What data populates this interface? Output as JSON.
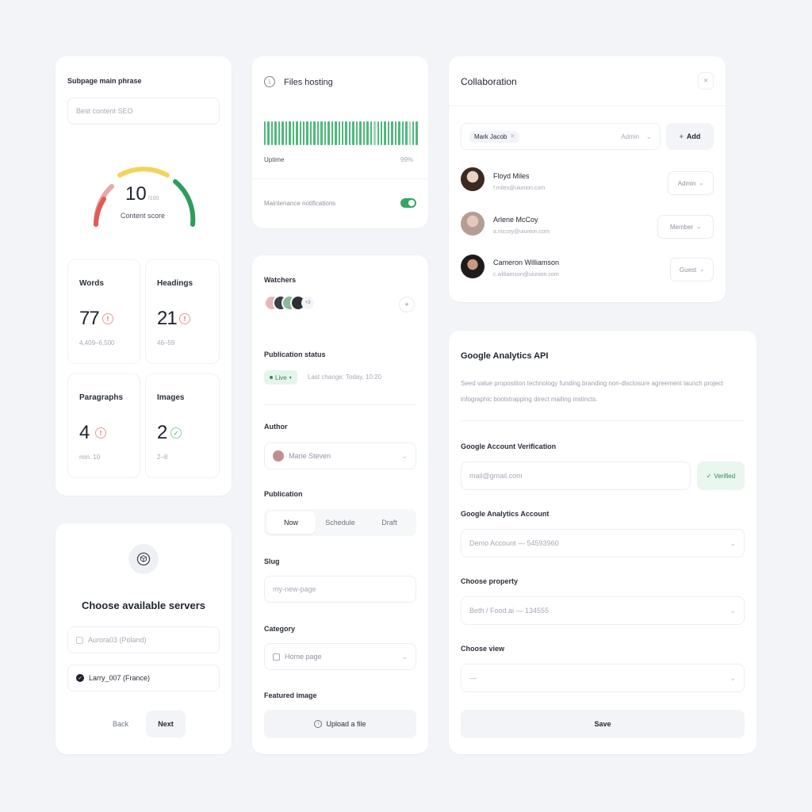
{
  "seo": {
    "label": "Subpage main phrase",
    "placeholder": "Best content SEO",
    "score": "10",
    "score_unit": "/100",
    "score_label": "Content score",
    "stats": [
      {
        "title": "Words",
        "value": "77",
        "range": "4,409–6,500",
        "status": "red"
      },
      {
        "title": "Headings",
        "value": "21",
        "range": "46–59",
        "status": "red"
      },
      {
        "title": "Paragraphs",
        "value": "4",
        "range": "min. 10",
        "status": "red"
      },
      {
        "title": "Images",
        "value": "2",
        "range": "2–8",
        "status": "green"
      }
    ],
    "gauge_level": 0.1
  },
  "servers": {
    "title": "Choose available servers",
    "options": [
      "Aurora03 (Poland)",
      "Larry_007 (France)"
    ],
    "selected_index": 1,
    "back_label": "Back",
    "next_label": "Next"
  },
  "hosting": {
    "title": "Files hosting",
    "uptime_label": "Uptime",
    "uptime_value": "99%",
    "maintenance_label": "Maintenance notifications",
    "maintenance_on": true
  },
  "publish": {
    "watchers_label": "Watchers",
    "watchers_extra": "+3",
    "status_label": "Publication status",
    "status_badge": "Live",
    "status_meta": "Last change: Today, 10:20",
    "author_label": "Author",
    "author_name": "Marie Steven",
    "publication_label": "Publication",
    "publication_options": [
      "Now",
      "Schedule",
      "Draft"
    ],
    "publication_selected": 0,
    "slug_label": "Slug",
    "slug_placeholder": "my-new-page",
    "category_label": "Category",
    "category_value": "Home page",
    "featured_label": "Featured image",
    "upload_label": "Upload a file"
  },
  "collab": {
    "title": "Collaboration",
    "invite_chip": "Mark Jacob",
    "invite_role": "Admin",
    "add_label": "Add",
    "members": [
      {
        "name": "Floyd Miles",
        "email": "f.miles@uiunion.com",
        "role": "Admin"
      },
      {
        "name": "Arlene McCoy",
        "email": "a.mccoy@uiunion.com",
        "role": "Member"
      },
      {
        "name": "Cameron Williamson",
        "email": "c.williamson@uiunion.com",
        "role": "Guest"
      }
    ]
  },
  "analytics": {
    "title": "Google Analytics API",
    "description": "Seed value proposition technology funding branding non-disclosure agreement launch project infographic bootstrapping direct mailing instincts.",
    "verification_label": "Google Account Verification",
    "email_placeholder": "mail@gmail.com",
    "verified_label": "Verified",
    "account_label": "Google Analytics Account",
    "account_value": "Demo Account — 54593960",
    "property_label": "Choose property",
    "property_value": "Beth / Food.ai — 134555",
    "view_label": "Choose view",
    "view_value": "—",
    "save_label": "Save"
  },
  "colors": {
    "accent_green": "#35a565",
    "warn_red": "#e05a5a",
    "gauge_yellow": "#f3d35c"
  }
}
